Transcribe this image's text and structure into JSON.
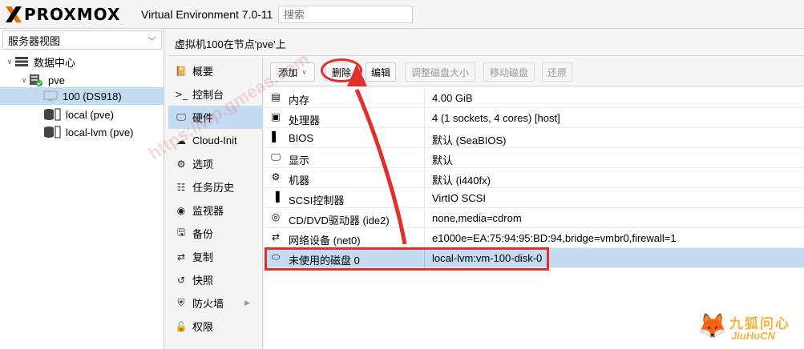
{
  "app": {
    "brand": "PROXMOX",
    "version": "Virtual Environment 7.0-11",
    "search_placeholder": "搜索"
  },
  "tree": {
    "view_label": "服务器视图",
    "items": [
      {
        "label": "数据中心",
        "icon": "datacenter-icon"
      },
      {
        "label": "pve",
        "icon": "node-icon"
      },
      {
        "label": "100 (DS918)",
        "icon": "vm-icon"
      },
      {
        "label": "local (pve)",
        "icon": "storage-icon"
      },
      {
        "label": "local-lvm (pve)",
        "icon": "storage-icon"
      }
    ]
  },
  "breadcrumb": "虚拟机100在节点'pve'上",
  "nav": {
    "items": [
      {
        "label": "概要",
        "icon": "summary-icon"
      },
      {
        "label": "控制台",
        "icon": "console-icon"
      },
      {
        "label": "硬件",
        "icon": "hardware-icon"
      },
      {
        "label": "Cloud-Init",
        "icon": "cloud-icon"
      },
      {
        "label": "选项",
        "icon": "options-icon"
      },
      {
        "label": "任务历史",
        "icon": "task-history-icon"
      },
      {
        "label": "监视器",
        "icon": "monitor-icon"
      },
      {
        "label": "备份",
        "icon": "backup-icon"
      },
      {
        "label": "复制",
        "icon": "replication-icon"
      },
      {
        "label": "快照",
        "icon": "snapshot-icon"
      },
      {
        "label": "防火墙",
        "icon": "firewall-icon"
      },
      {
        "label": "权限",
        "icon": "permissions-icon"
      }
    ]
  },
  "toolbar": {
    "add": "添加",
    "remove": "删除",
    "edit": "编辑",
    "resize": "调整磁盘大小",
    "move": "移动磁盘",
    "revert": "还原"
  },
  "hardware": [
    {
      "label": "内存",
      "value": "4.00 GiB",
      "icon": "memory-icon"
    },
    {
      "label": "处理器",
      "value": "4 (1 sockets, 4 cores) [host]",
      "icon": "cpu-icon"
    },
    {
      "label": "BIOS",
      "value": "默认 (SeaBIOS)",
      "icon": "bios-icon"
    },
    {
      "label": "显示",
      "value": "默认",
      "icon": "display-icon"
    },
    {
      "label": "机器",
      "value": "默认 (i440fx)",
      "icon": "machine-icon"
    },
    {
      "label": "SCSI控制器",
      "value": "VirtIO SCSI",
      "icon": "scsi-icon"
    },
    {
      "label": "CD/DVD驱动器 (ide2)",
      "value": "none,media=cdrom",
      "icon": "cdrom-icon"
    },
    {
      "label": "网络设备 (net0)",
      "value": "e1000e=EA:75:94:95:BD:94,bridge=vmbr0,firewall=1",
      "icon": "network-icon"
    },
    {
      "label": "未使用的磁盘 0",
      "value": "local-lvm:vm-100-disk-0",
      "icon": "disk-icon"
    }
  ],
  "watermark": {
    "corner_cn": "九狐问心",
    "corner_en": "JiuHuCN"
  },
  "colors": {
    "selection": "#c4dcf2",
    "annotation": "#e0302a",
    "brand_orange": "#e57000"
  }
}
